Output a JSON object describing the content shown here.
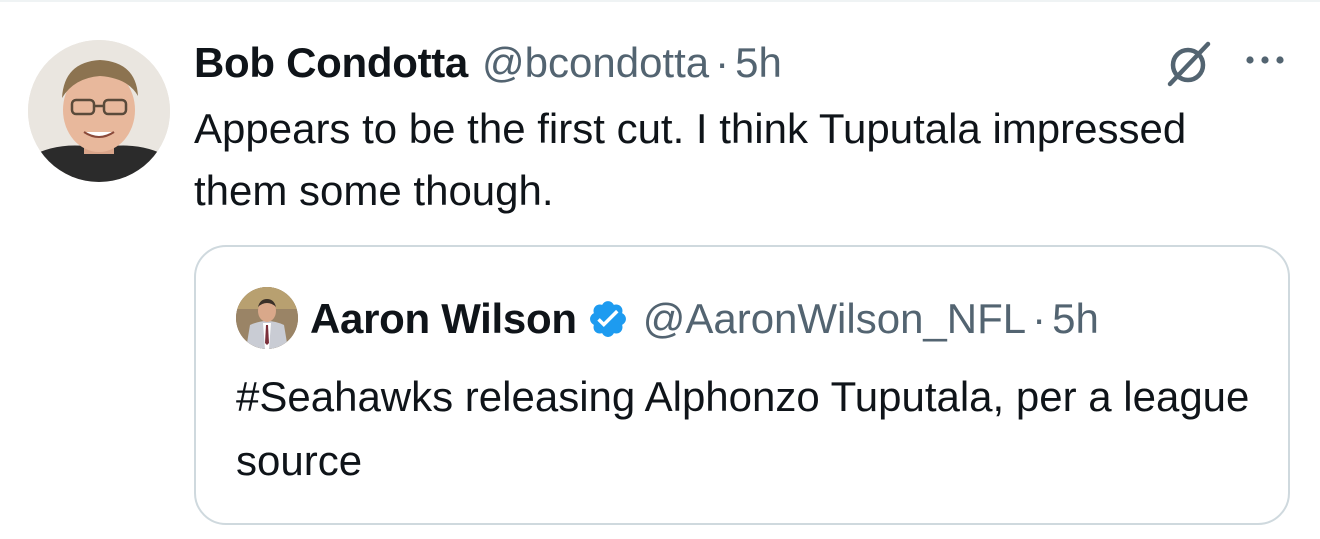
{
  "tweet": {
    "author_name": "Bob Condotta",
    "author_handle": "@bcondotta",
    "separator": "·",
    "timestamp": "5h",
    "text": "Appears to be the first cut. I think Tuputala impressed them some though."
  },
  "quoted_tweet": {
    "author_name": "Aaron Wilson",
    "verified": true,
    "author_handle": "@AaronWilson_NFL",
    "separator": "·",
    "timestamp": "5h",
    "text": "#Seahawks releasing Alphonzo Tuputala, per a league source"
  },
  "icons": {
    "grok": "grok-icon",
    "more": "more-icon",
    "verified": "verified-badge-icon"
  },
  "colors": {
    "text_primary": "#0f1419",
    "text_secondary": "#536471",
    "verified_blue": "#1d9bf0",
    "border": "#cfd9de"
  }
}
